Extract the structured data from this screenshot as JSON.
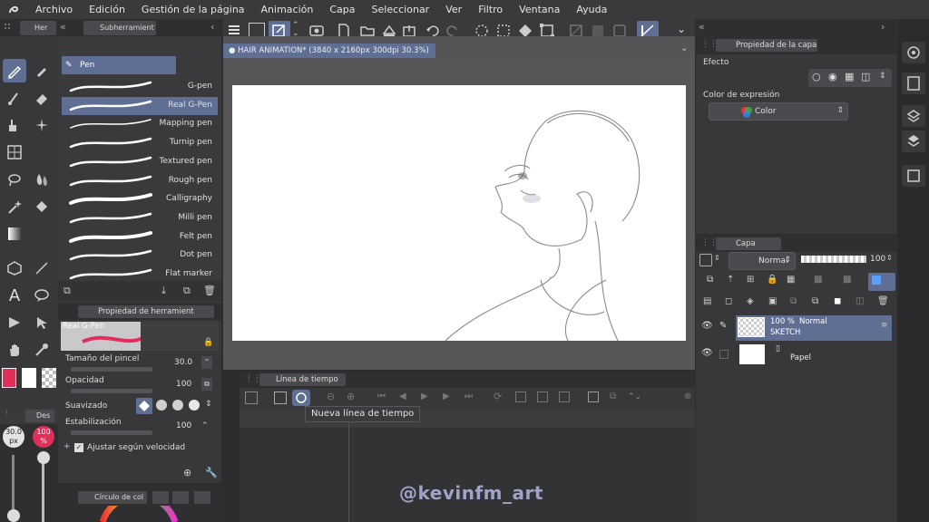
{
  "menubar": {
    "items": [
      "Archivo",
      "Edición",
      "Gestión de la página",
      "Animación",
      "Capa",
      "Seleccionar",
      "Ver",
      "Filtro",
      "Ventana",
      "Ayuda"
    ]
  },
  "left_top_tab": "Her",
  "subtool": {
    "tab": "Subherramient",
    "group": "Pen",
    "brushes": [
      "G-pen",
      "Real G-Pen",
      "Mapping pen",
      "Turnip pen",
      "Textured pen",
      "Rough pen",
      "Calligraphy",
      "Milli pen",
      "Felt pen",
      "Dot pen",
      "Flat marker"
    ],
    "selected_index": 1
  },
  "tool_property": {
    "tab": "Propiedad de herramient",
    "preset_name": "Real G-Pen",
    "brush_size_label": "Tamaño del pincel",
    "brush_size_value": "30.0",
    "opacity_label": "Opacidad",
    "opacity_value": "100",
    "smoothing_label": "Suavizado",
    "stabilization_label": "Estabilización",
    "stabilization_value": "100",
    "velocity_label": "Ajustar según velocidad"
  },
  "brush_size_panel": {
    "tab": "Des",
    "size": "30.0",
    "size_unit": "px",
    "opacity": "100",
    "opacity_unit": "%"
  },
  "color_wheel_tab": "Círculo de col",
  "canvas": {
    "doc_title": "HAIR ANIMATION* (3840 x 2160px 300dpi 30.3%)"
  },
  "timeline": {
    "tab": "Línea de tiempo",
    "tooltip": "Nueva línea de tiempo"
  },
  "layer_property": {
    "tab": "Propiedad de la capa",
    "effect_label": "Efecto",
    "expression_color_label": "Color de expresión",
    "expression_color_value": "Color"
  },
  "layers": {
    "tab": "Capa",
    "blend_mode": "Normal",
    "opacity": "100",
    "items": [
      {
        "percent": "100 %",
        "mode": "Normal",
        "name": "SKETCH"
      },
      {
        "name": "Papel"
      }
    ]
  },
  "watermark": "@kevinfm_art",
  "colors": {
    "accent": "#5f6f93",
    "main_color": "#e0305a",
    "sub_color": "#ffffff"
  }
}
